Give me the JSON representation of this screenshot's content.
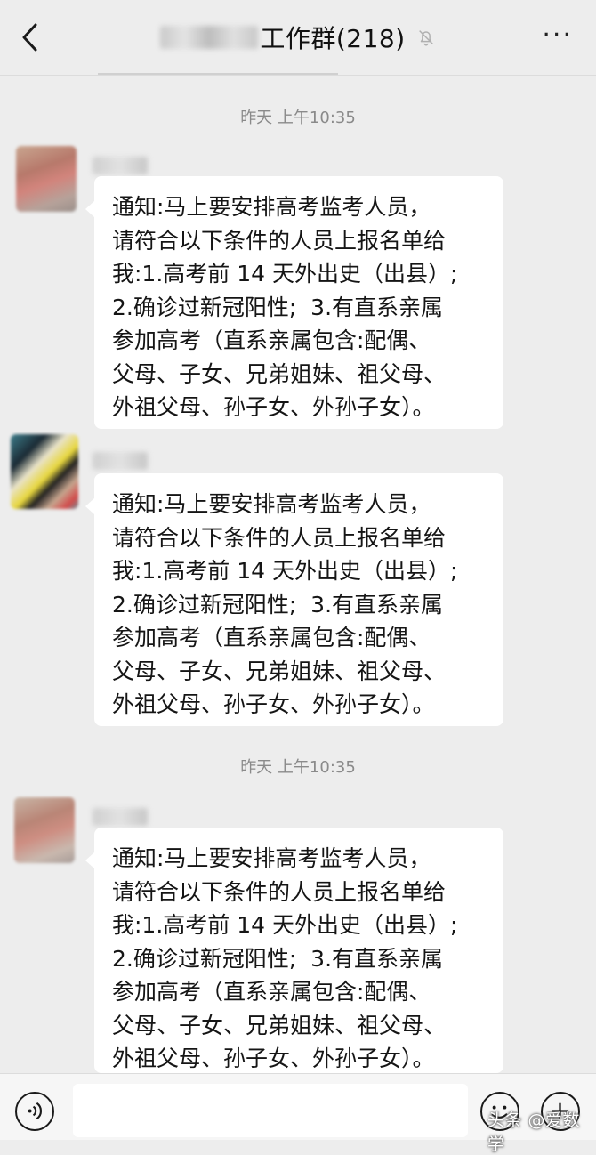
{
  "header": {
    "title": "工作群(218)",
    "more_label": "···"
  },
  "messages": [
    {
      "timestamp": "昨天 上午10:35",
      "text": "通知:马上要安排高考监考人员，\n请符合以下条件的人员上报名单给\n我:1.高考前 14 天外出史（出县）;\n2.确诊过新冠阳性;  3.有直系亲属\n参加高考（直系亲属包含:配偶、\n父母、子女、兄弟姐妹、祖父母、\n外祖父母、孙子女、外孙子女）。"
    },
    {
      "timestamp": "",
      "text": "通知:马上要安排高考监考人员，\n请符合以下条件的人员上报名单给\n我:1.高考前 14 天外出史（出县）;\n2.确诊过新冠阳性;  3.有直系亲属\n参加高考（直系亲属包含:配偶、\n父母、子女、兄弟姐妹、祖父母、\n外祖父母、孙子女、外孙子女）。"
    },
    {
      "timestamp": "昨天 上午10:35",
      "text": "通知:马上要安排高考监考人员，\n请符合以下条件的人员上报名单给\n我:1.高考前 14 天外出史（出县）;\n2.确诊过新冠阳性;  3.有直系亲属\n参加高考（直系亲属包含:配偶、\n父母、子女、兄弟姐妹、祖父母、\n外祖父母、孙子女、外孙子女）。"
    }
  ],
  "watermark": "头条 @爱数学",
  "icons": {
    "back": "chevron-left-icon",
    "mute": "bell-off-icon",
    "more": "more-dots-icon",
    "voice": "voice-icon",
    "emoji": "emoji-icon",
    "plus": "plus-icon"
  },
  "colors": {
    "background": "#ededed",
    "bubble": "#ffffff",
    "timestamp": "#8a8a8a"
  }
}
